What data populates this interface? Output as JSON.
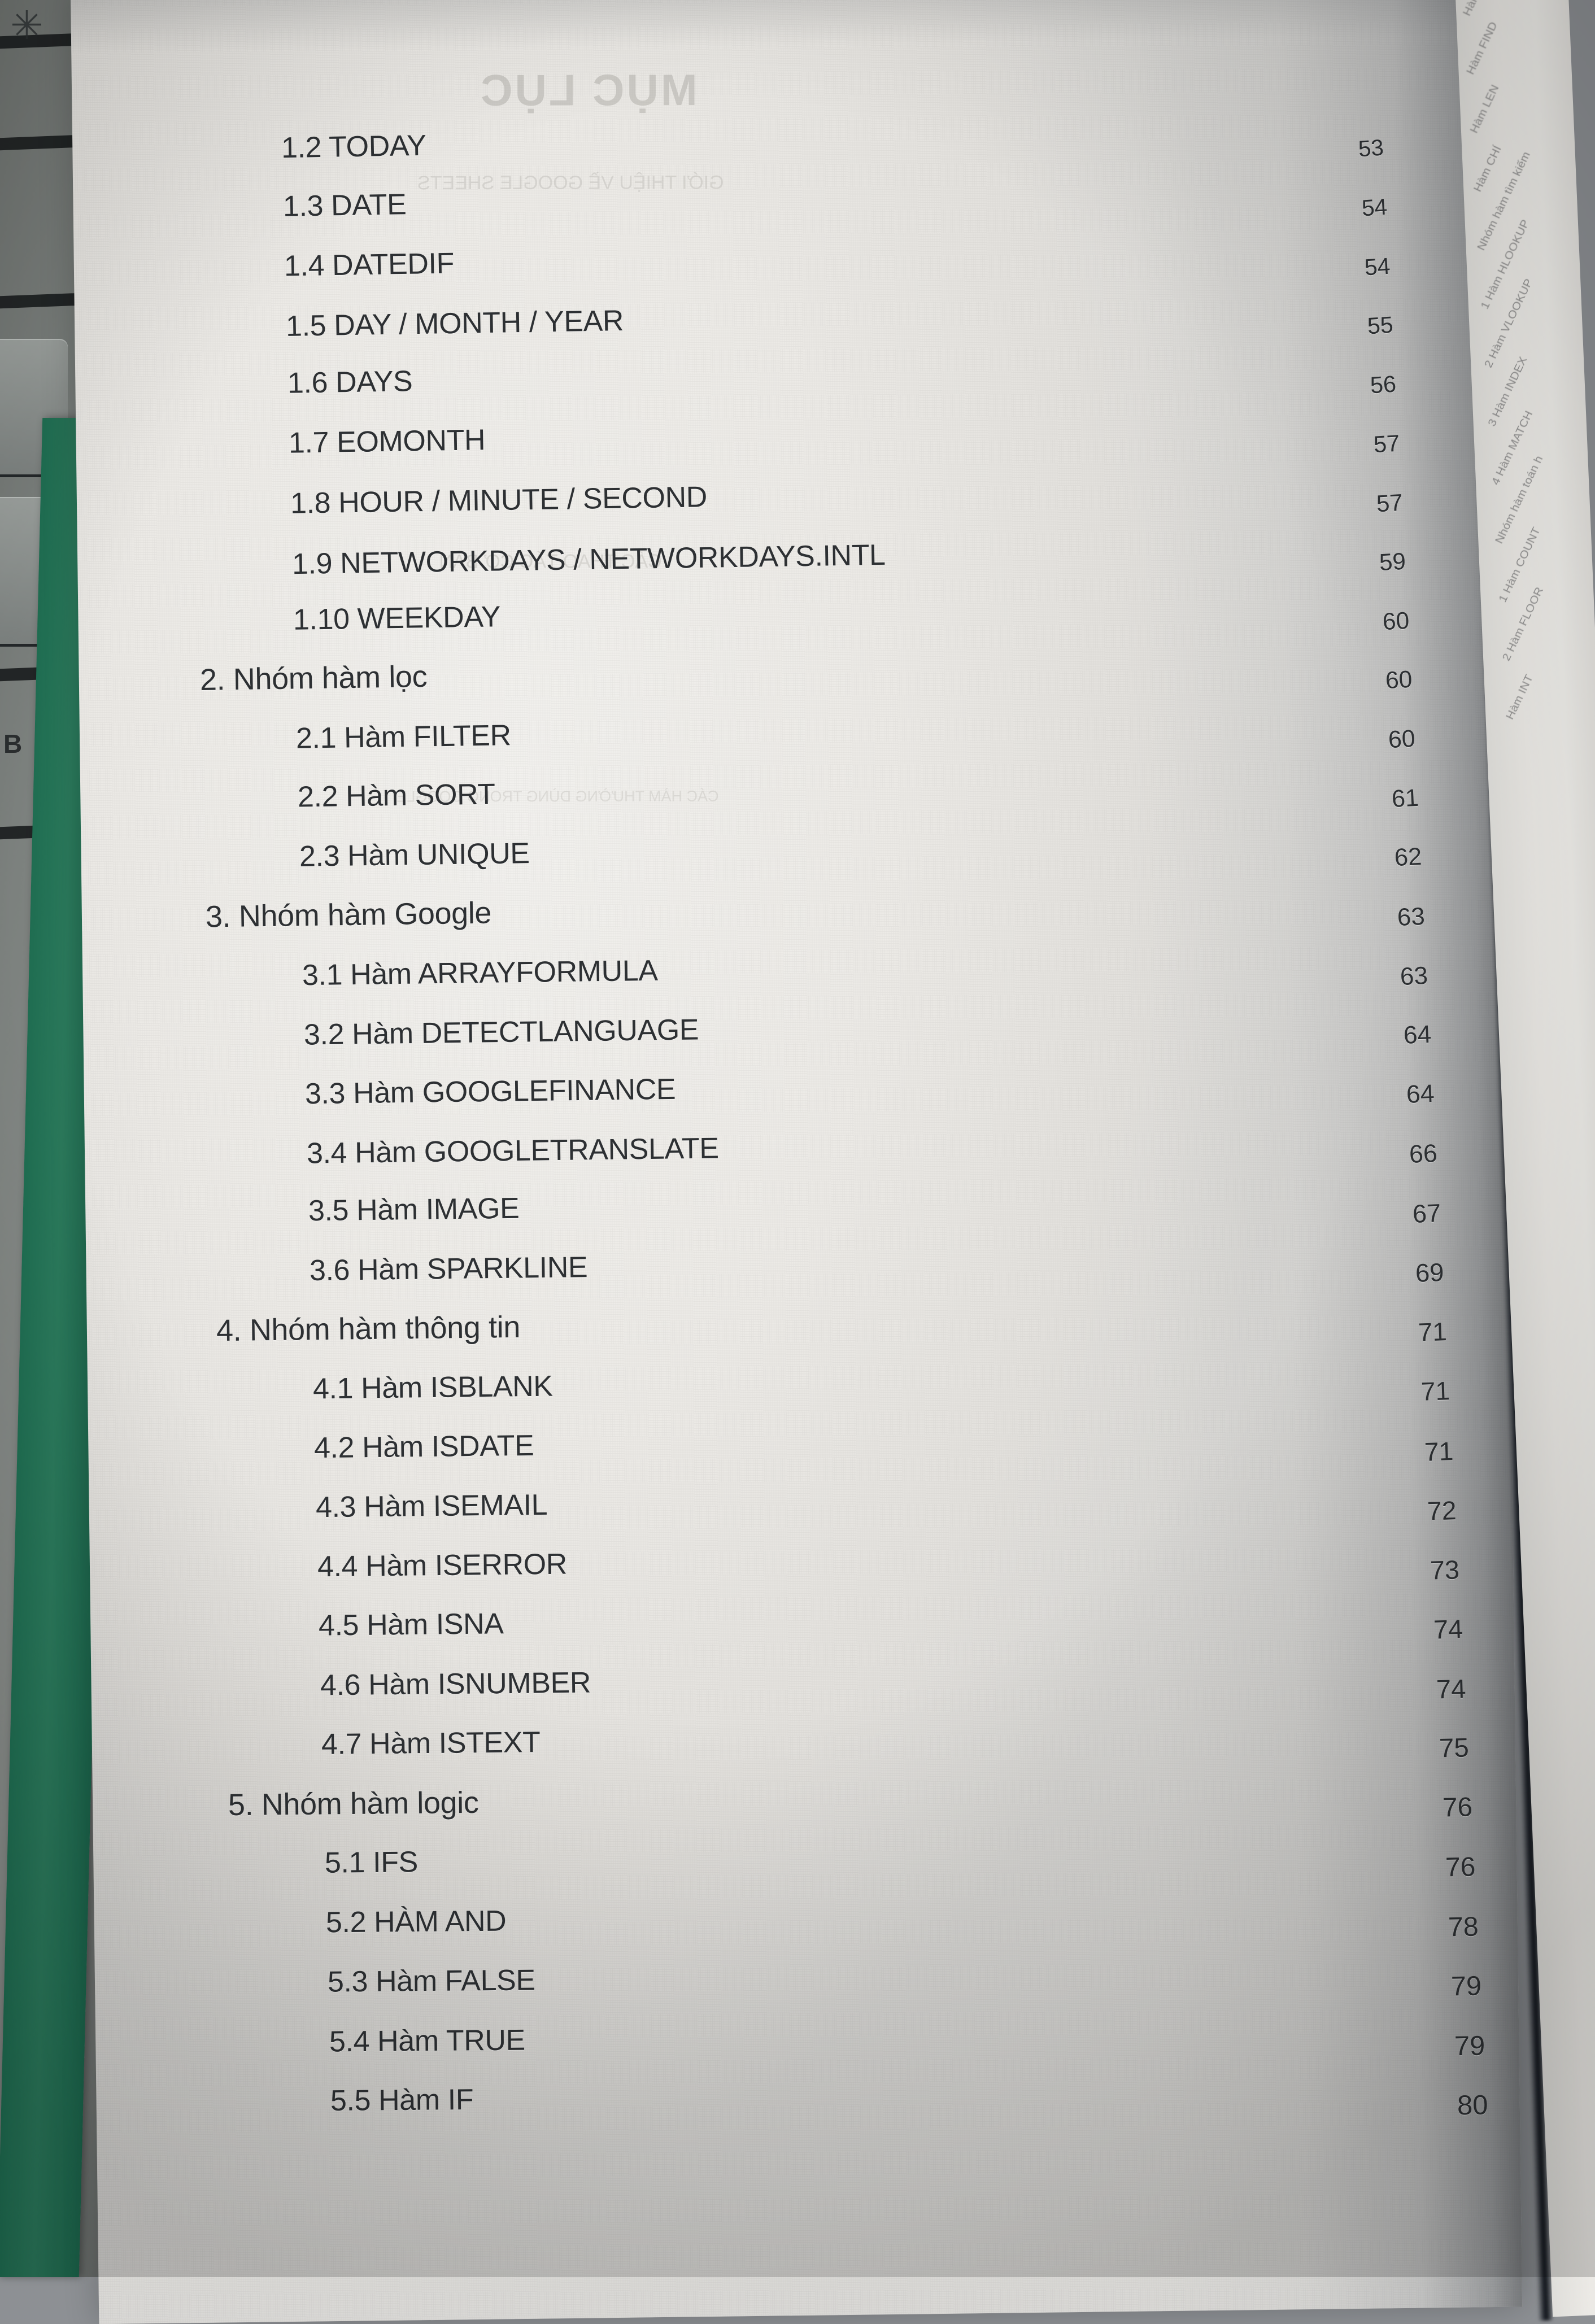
{
  "photo": {
    "subject": "printed book table of contents page",
    "language": "Vietnamese",
    "ghost_heading": "MỤC LỤC"
  },
  "toc": {
    "entries": [
      {
        "label": "1.2 TODAY",
        "page": "",
        "level": 2
      },
      {
        "label": "1.3 DATE",
        "page": "53",
        "level": 2
      },
      {
        "label": "1.4 DATEDIF",
        "page": "54",
        "level": 2
      },
      {
        "label": "1.5 DAY / MONTH / YEAR",
        "page": "54",
        "level": 2
      },
      {
        "label": "1.6 DAYS",
        "page": "55",
        "level": 2
      },
      {
        "label": "1.7 EOMONTH",
        "page": "56",
        "level": 2
      },
      {
        "label": "1.8 HOUR / MINUTE / SECOND",
        "page": "57",
        "level": 2
      },
      {
        "label": "1.9 NETWORKDAYS / NETWORKDAYS.INTL",
        "page": "57",
        "level": 2
      },
      {
        "label": "1.10 WEEKDAY",
        "page": "59",
        "level": 2
      },
      {
        "label": "2. Nhóm hàm lọc",
        "page": "60",
        "level": 1
      },
      {
        "label": "2.1 Hàm FILTER",
        "page": "60",
        "level": 2
      },
      {
        "label": "2.2 Hàm SORT",
        "page": "60",
        "level": 2
      },
      {
        "label": "2.3 Hàm UNIQUE",
        "page": "61",
        "level": 2
      },
      {
        "label": "3. Nhóm hàm Google",
        "page": "62",
        "level": 1
      },
      {
        "label": "3.1 Hàm ARRAYFORMULA",
        "page": "63",
        "level": 2
      },
      {
        "label": "3.2 Hàm DETECTLANGUAGE",
        "page": "63",
        "level": 2
      },
      {
        "label": "3.3 Hàm GOOGLEFINANCE",
        "page": "64",
        "level": 2
      },
      {
        "label": "3.4 Hàm GOOGLETRANSLATE",
        "page": "64",
        "level": 2
      },
      {
        "label": "3.5 Hàm IMAGE",
        "page": "66",
        "level": 2
      },
      {
        "label": "3.6 Hàm SPARKLINE",
        "page": "67",
        "level": 2
      },
      {
        "label": "4. Nhóm hàm thông tin",
        "page": "69",
        "level": 1
      },
      {
        "label": "4.1 Hàm ISBLANK",
        "page": "71",
        "level": 2
      },
      {
        "label": "4.2 Hàm ISDATE",
        "page": "71",
        "level": 2
      },
      {
        "label": "4.3 Hàm ISEMAIL",
        "page": "71",
        "level": 2
      },
      {
        "label": "4.4 Hàm ISERROR",
        "page": "72",
        "level": 2
      },
      {
        "label": "4.5 Hàm ISNA",
        "page": "73",
        "level": 2
      },
      {
        "label": "4.6 Hàm ISNUMBER",
        "page": "74",
        "level": 2
      },
      {
        "label": "4.7 Hàm ISTEXT",
        "page": "74",
        "level": 2
      },
      {
        "label": "5. Nhóm hàm logic",
        "page": "75",
        "level": 1
      },
      {
        "label": "5.1 IFS",
        "page": "76",
        "level": 2
      },
      {
        "label": "5.2 HÀM AND",
        "page": "76",
        "level": 2
      },
      {
        "label": "5.3 Hàm FALSE",
        "page": "78",
        "level": 2
      },
      {
        "label": "5.4 Hàm TRUE",
        "page": "79",
        "level": 2
      },
      {
        "label": "5.5 Hàm IF",
        "page": "79",
        "level": 2
      },
      {
        "label": "",
        "page": "80",
        "level": 2
      }
    ]
  },
  "facing_page": {
    "lines": [
      "Hàm SEARCH",
      "Hàm FIND",
      "Hàm LEN",
      "Hàm CHỈ",
      "Nhóm hàm tìm kiếm",
      "1 Hàm HLOOKUP",
      "2 Hàm VLOOKUP",
      "3 Hàm INDEX",
      "4 Hàm MATCH",
      "Nhóm hàm toán h",
      "1 Hàm COUNT",
      "2 Hàm FLOOR",
      "Hàm INT"
    ]
  },
  "ghost_text": {
    "heading": "MỤC LỤC",
    "lines": [
      "GIỚI THIỆU VỀ GOOGLE SHEETS",
      "CÁC THAO TÁC CƠ BẢN",
      "CÁC HÀM THƯỜNG DÙNG TRONG GOOGLE"
    ]
  },
  "colors": {
    "page": "#eceae6",
    "ink": "#2d3033",
    "green_spine": "#23725660",
    "gutter": "#141820",
    "desk": "#7e8380"
  }
}
